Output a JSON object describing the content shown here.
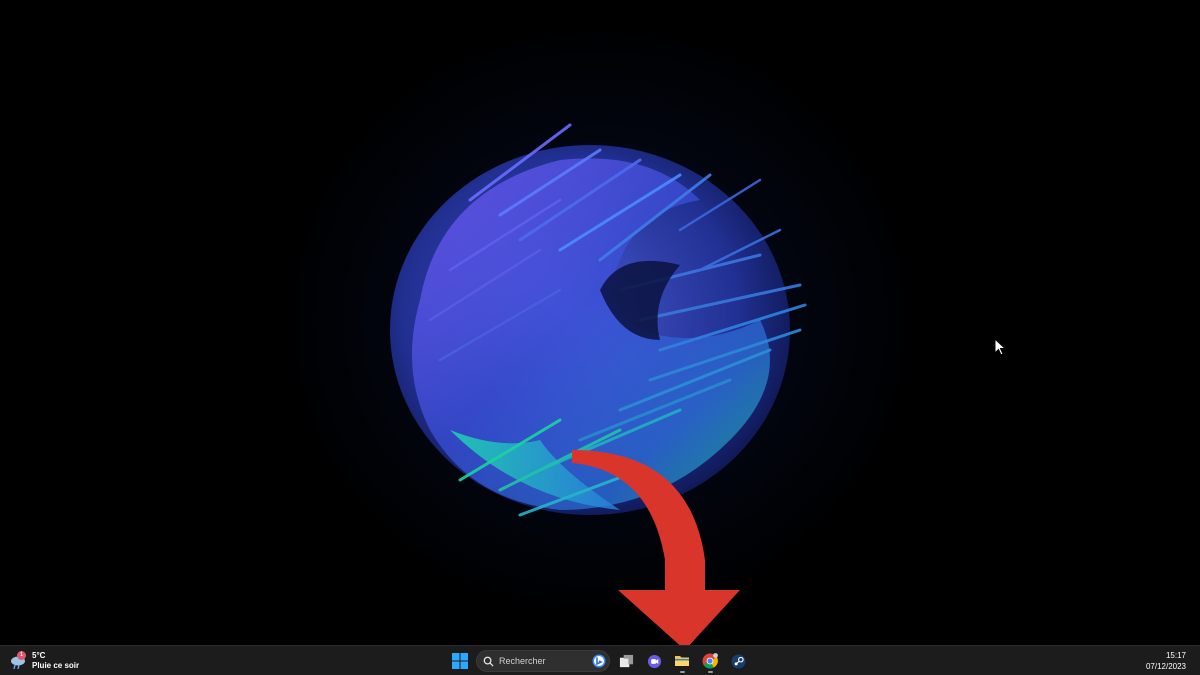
{
  "weather": {
    "temperature": "5°C",
    "description": "Pluie ce soir",
    "badge_count": "1",
    "icon": "rain-cloud-icon"
  },
  "taskbar": {
    "start_icon": "windows-start-icon",
    "search_placeholder": "Rechercher",
    "search_icon": "search-icon",
    "bing_icon": "bing-icon",
    "apps": [
      {
        "name": "task-view",
        "icon": "task-view-icon"
      },
      {
        "name": "teams-chat",
        "icon": "teams-icon"
      },
      {
        "name": "file-explorer",
        "icon": "folder-icon"
      },
      {
        "name": "chrome",
        "icon": "chrome-icon"
      },
      {
        "name": "steam",
        "icon": "steam-icon"
      }
    ]
  },
  "clock": {
    "time": "15:17",
    "date": "07/12/2023"
  },
  "colors": {
    "taskbar_bg": "#1c1c1c",
    "arrow_red": "#d9352b",
    "windows_blue": "#2ea7ff",
    "folder_yellow": "#f5c542"
  }
}
